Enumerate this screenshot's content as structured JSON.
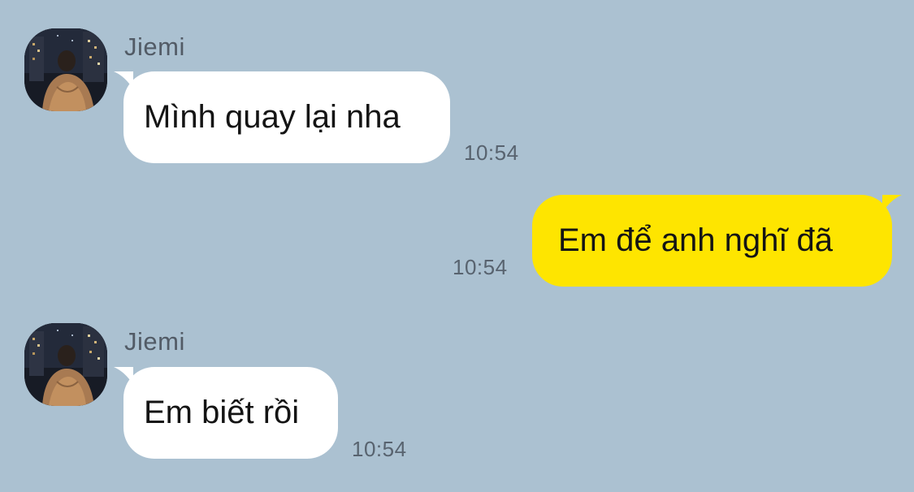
{
  "colors": {
    "background": "#abc1d1",
    "incoming_bubble": "#ffffff",
    "outgoing_bubble": "#fee500"
  },
  "messages": [
    {
      "direction": "incoming",
      "sender": "Jiemi",
      "text": "Mình quay lại nha",
      "time": "10:54"
    },
    {
      "direction": "outgoing",
      "text": "Em để anh nghĩ đã",
      "time": "10:54"
    },
    {
      "direction": "incoming",
      "sender": "Jiemi",
      "text": "Em biết rồi",
      "time": "10:54"
    }
  ],
  "icons": {
    "avatar": "profile-photo-icon"
  }
}
